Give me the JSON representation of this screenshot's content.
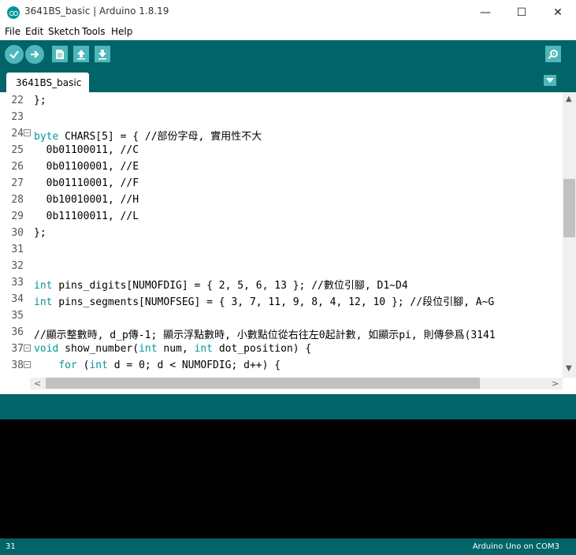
{
  "window": {
    "title": "3641BS_basic | Arduino 1.8.19",
    "minimize": "—",
    "maximize": "☐",
    "close": "✕"
  },
  "menu": [
    "File",
    "Edit",
    "Sketch",
    "Tools",
    "Help"
  ],
  "toolbar": [
    "verify",
    "upload",
    "new",
    "open",
    "save",
    "serial-monitor"
  ],
  "tab": {
    "label": "3641BS_basic"
  },
  "editor": {
    "lines": [
      {
        "n": "22",
        "fold": false,
        "code": "};"
      },
      {
        "n": "23",
        "fold": false,
        "code": ""
      },
      {
        "n": "24",
        "fold": true,
        "kw": "byte",
        "code": " CHARS[5] = { //部份字母, 實用性不大"
      },
      {
        "n": "25",
        "fold": false,
        "code": "  0b01100011, //C"
      },
      {
        "n": "26",
        "fold": false,
        "code": "  0b01100001, //E"
      },
      {
        "n": "27",
        "fold": false,
        "code": "  0b01110001, //F"
      },
      {
        "n": "28",
        "fold": false,
        "code": "  0b10010001, //H"
      },
      {
        "n": "29",
        "fold": false,
        "code": "  0b11100011, //L"
      },
      {
        "n": "30",
        "fold": false,
        "code": "};"
      },
      {
        "n": "31",
        "fold": false,
        "code": ""
      },
      {
        "n": "32",
        "fold": false,
        "code": ""
      },
      {
        "n": "33",
        "fold": false,
        "kw": "int",
        "code": " pins_digits[NUMOFDIG] = { 2, 5, 6, 13 }; //數位引腳, D1~D4"
      },
      {
        "n": "34",
        "fold": false,
        "kw": "int",
        "code": " pins_segments[NUMOFSEG] = { 3, 7, 11, 9, 8, 4, 12, 10 }; //段位引腳, A~G"
      },
      {
        "n": "35",
        "fold": false,
        "code": ""
      },
      {
        "n": "36",
        "fold": false,
        "code": "//顯示整數時, d_p傳-1; 顯示浮點數時, 小數點位從右往左0起計數, 如顯示pi, 則傳參爲(3141"
      },
      {
        "n": "37",
        "fold": true,
        "kw": "void",
        "code": " show_number(",
        "kw2": "int",
        "code2": " num, ",
        "kw3": "int",
        "code3": " dot_position) {"
      },
      {
        "n": "38",
        "fold": true,
        "indent": "    ",
        "kw": "for",
        "code": " (",
        "kw2": "int",
        "code2": " d = 0; d < NUMOFDIG; d++) {"
      }
    ]
  },
  "status": {
    "line": "31",
    "board": "Arduino Uno on COM3"
  },
  "colors": {
    "teal_dark": "#006468",
    "teal_light": "#4db7bb",
    "keyword": "#00979c"
  }
}
